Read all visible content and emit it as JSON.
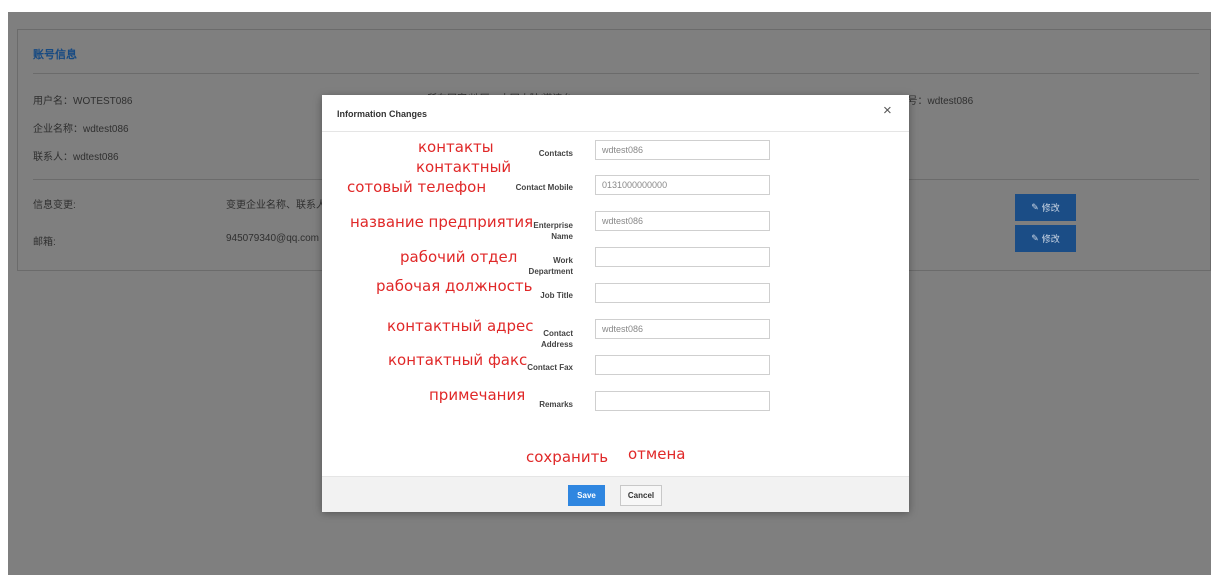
{
  "page": {
    "card_title": "账号信息",
    "username": "用户名：WOTEST086",
    "top_middle_text": "所在国家/地区：中国大陆/港澳台",
    "top_right_text": "所在国家/地区/统一编号：wdtest086",
    "company": "企业名称：wdtest086",
    "contact": "联系人：wdtest086",
    "info_change_label": "信息变更:",
    "info_change_value": "变更企业名称、联系人、",
    "email_label": "邮箱:",
    "email_value": "945079340@qq.com",
    "edit_button": "修改"
  },
  "modal": {
    "title": "Information Changes",
    "close_label": "×",
    "fields": [
      {
        "label": "Contacts",
        "value": "wdtest086",
        "annotation": "контакты"
      },
      {
        "label": "Contact Mobile",
        "value": "0131000000000",
        "annotation": "сотовый телефон",
        "annotation_top": "контактный"
      },
      {
        "label": "Enterprise Name",
        "value": "wdtest086",
        "annotation": "название предприятия"
      },
      {
        "label": "Work Department",
        "value": "",
        "annotation": "рабочий отдел"
      },
      {
        "label": "Job Title",
        "value": "",
        "annotation": "рабочая должность"
      },
      {
        "label": "Contact Address",
        "value": "wdtest086",
        "annotation": "контактный адрес"
      },
      {
        "label": "Contact Fax",
        "value": "",
        "annotation": "контактный факс"
      },
      {
        "label": "Remarks",
        "value": "",
        "annotation": "примечания"
      }
    ],
    "save_annotation": "сохранить",
    "cancel_annotation": "отмена",
    "save_label": "Save",
    "cancel_label": "Cancel"
  },
  "colors": {
    "overlay": "#7f7f7f",
    "save_button": "#2f86e0",
    "edit_button": "#1b4d86",
    "annotation": "#e02828"
  }
}
